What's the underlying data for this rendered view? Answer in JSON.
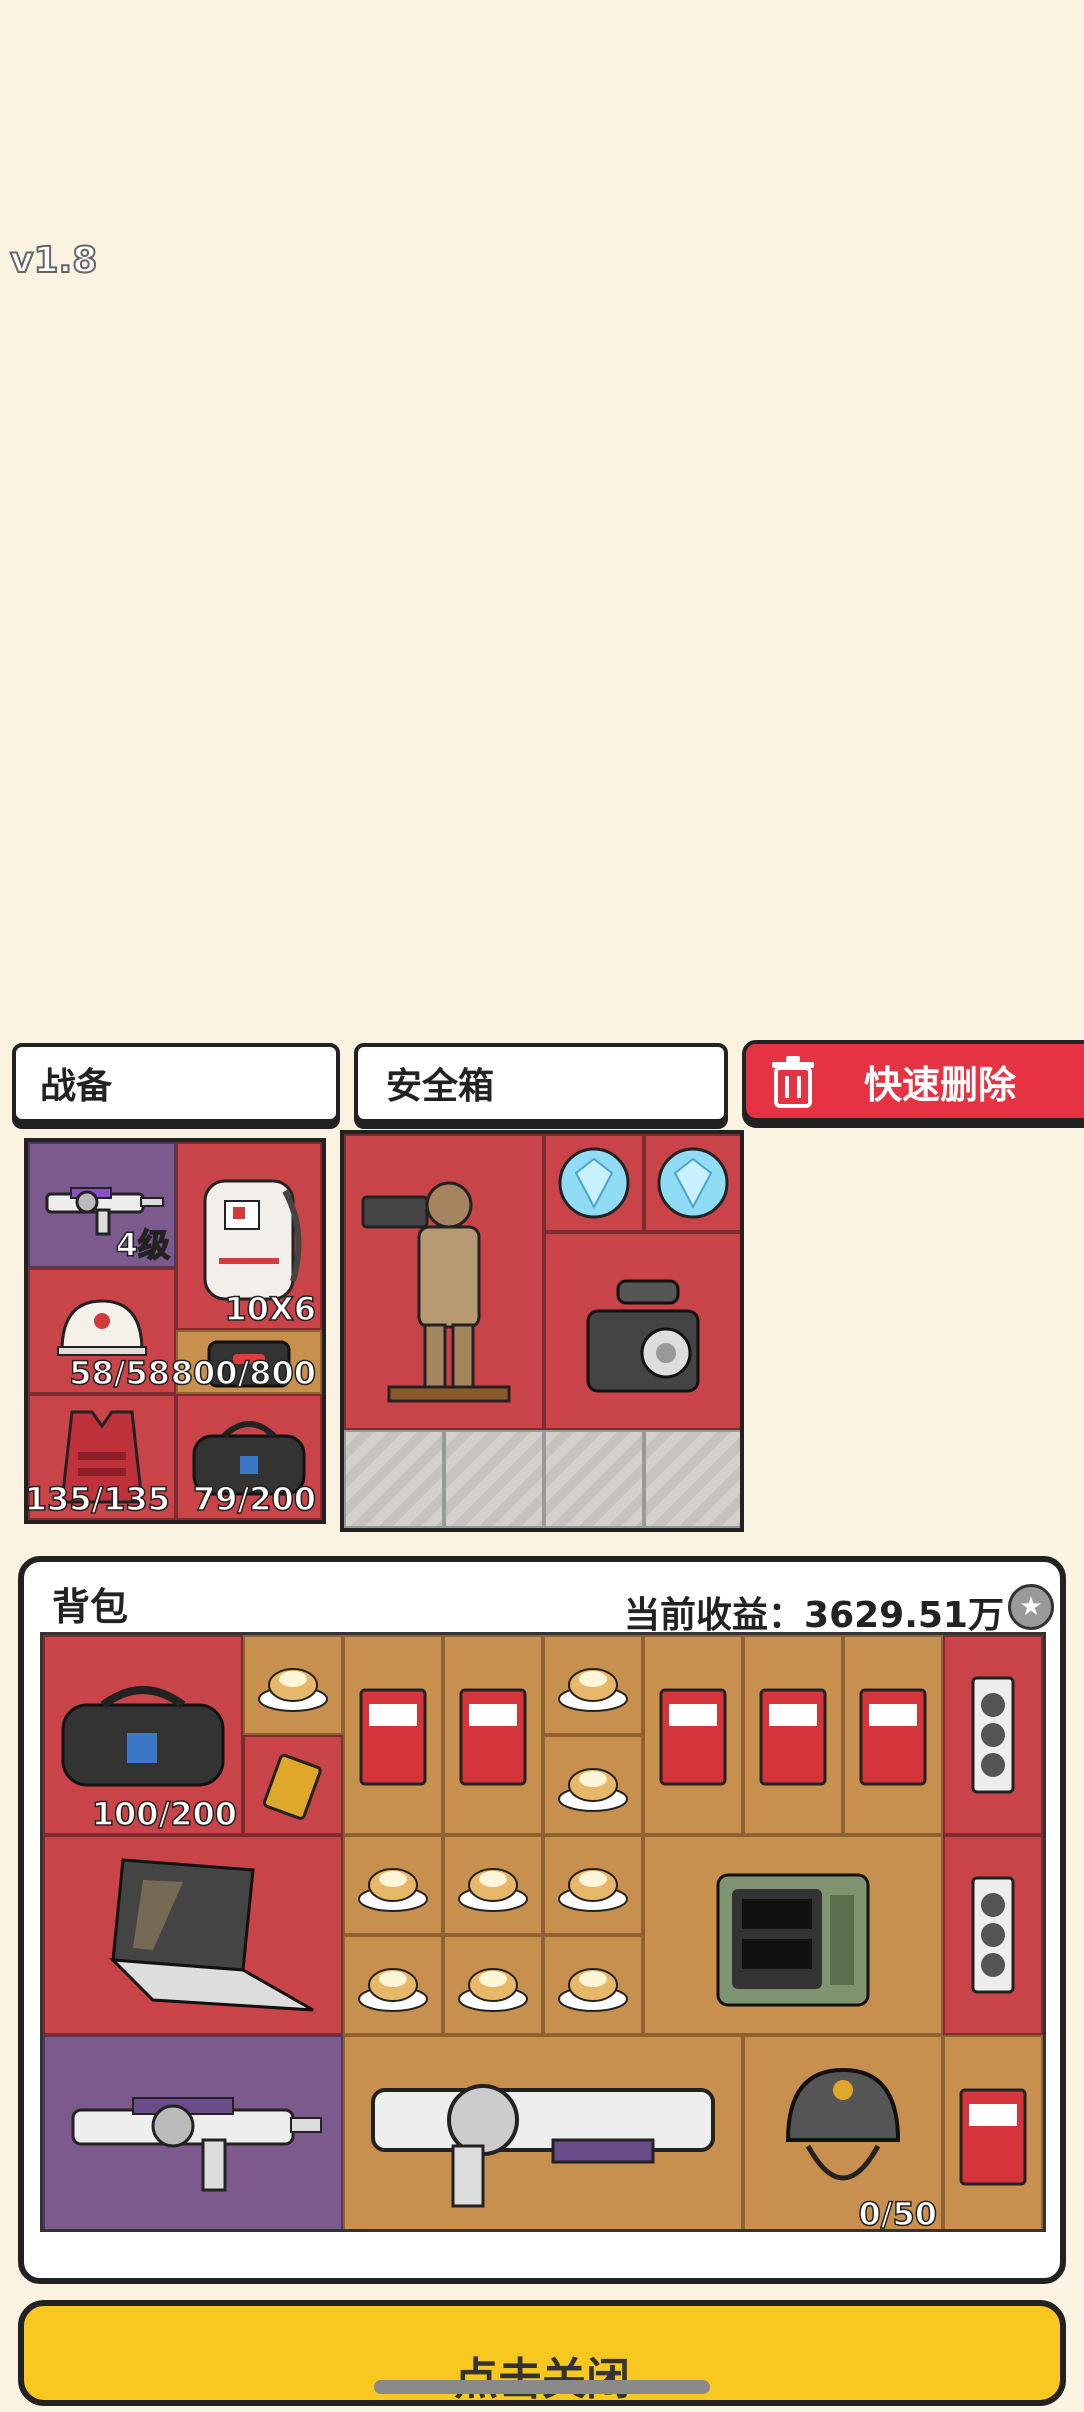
{
  "version": "v1.8",
  "tabs": {
    "gear": "战备",
    "safe_box": "安全箱"
  },
  "quick_delete": {
    "label": "快速删除",
    "icon": "trash-icon"
  },
  "gear_slots": [
    {
      "name": "weapon",
      "label": "4级",
      "icon": "rifle-icon"
    },
    {
      "name": "backpack",
      "label": "10X6",
      "icon": "backpack-icon"
    },
    {
      "name": "helmet",
      "label": "58/58",
      "icon": "helmet-icon"
    },
    {
      "name": "chest-rig",
      "label": "800/800",
      "icon": "chest-rig-icon"
    },
    {
      "name": "armor",
      "label": "135/135",
      "icon": "armor-vest-icon"
    },
    {
      "name": "pouch",
      "label": "79/200",
      "icon": "duffel-bag-icon"
    }
  ],
  "safe_box_items": [
    {
      "name": "terracotta-warrior",
      "icon": "statue-icon"
    },
    {
      "name": "diamond-1",
      "icon": "diamond-icon"
    },
    {
      "name": "diamond-2",
      "icon": "diamond-icon"
    },
    {
      "name": "camera",
      "icon": "camera-icon"
    }
  ],
  "backpack": {
    "title": "背包",
    "income_label": "当前收益：3629.51万",
    "coin_icon": "coin-icon",
    "items": [
      {
        "name": "duffel-bag",
        "label": "100/200",
        "icon": "duffel-bag-icon"
      },
      {
        "name": "helmet-grey",
        "label": "0/50",
        "icon": "helmet-icon"
      }
    ]
  },
  "close_button": "点击关闭",
  "colors": {
    "red": "#c84448",
    "tan": "#c8904e",
    "purple": "#7d5a8e",
    "yellow": "#f8c820",
    "delete_red": "#e53343"
  }
}
